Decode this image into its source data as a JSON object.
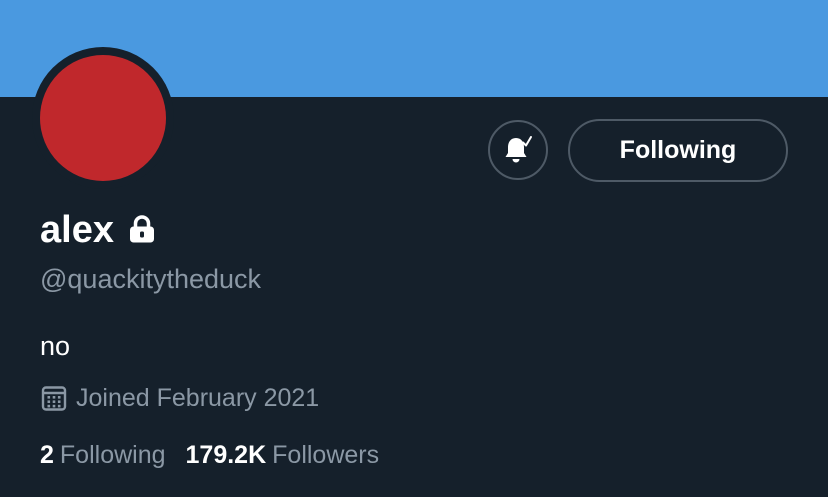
{
  "profile": {
    "banner_color": "#4a99e0",
    "avatar_color": "#c0282c",
    "display_name": "alex",
    "protected_icon": "lock-icon",
    "handle": "@quackitytheduck",
    "bio": "no",
    "joined_icon": "calendar-icon",
    "joined": "Joined February 2021"
  },
  "actions": {
    "notifications_icon": "bell-with-check-icon",
    "following_label": "Following"
  },
  "stats": {
    "following_count": "2",
    "following_label": "Following",
    "followers_count": "179.2K",
    "followers_label": "Followers"
  }
}
